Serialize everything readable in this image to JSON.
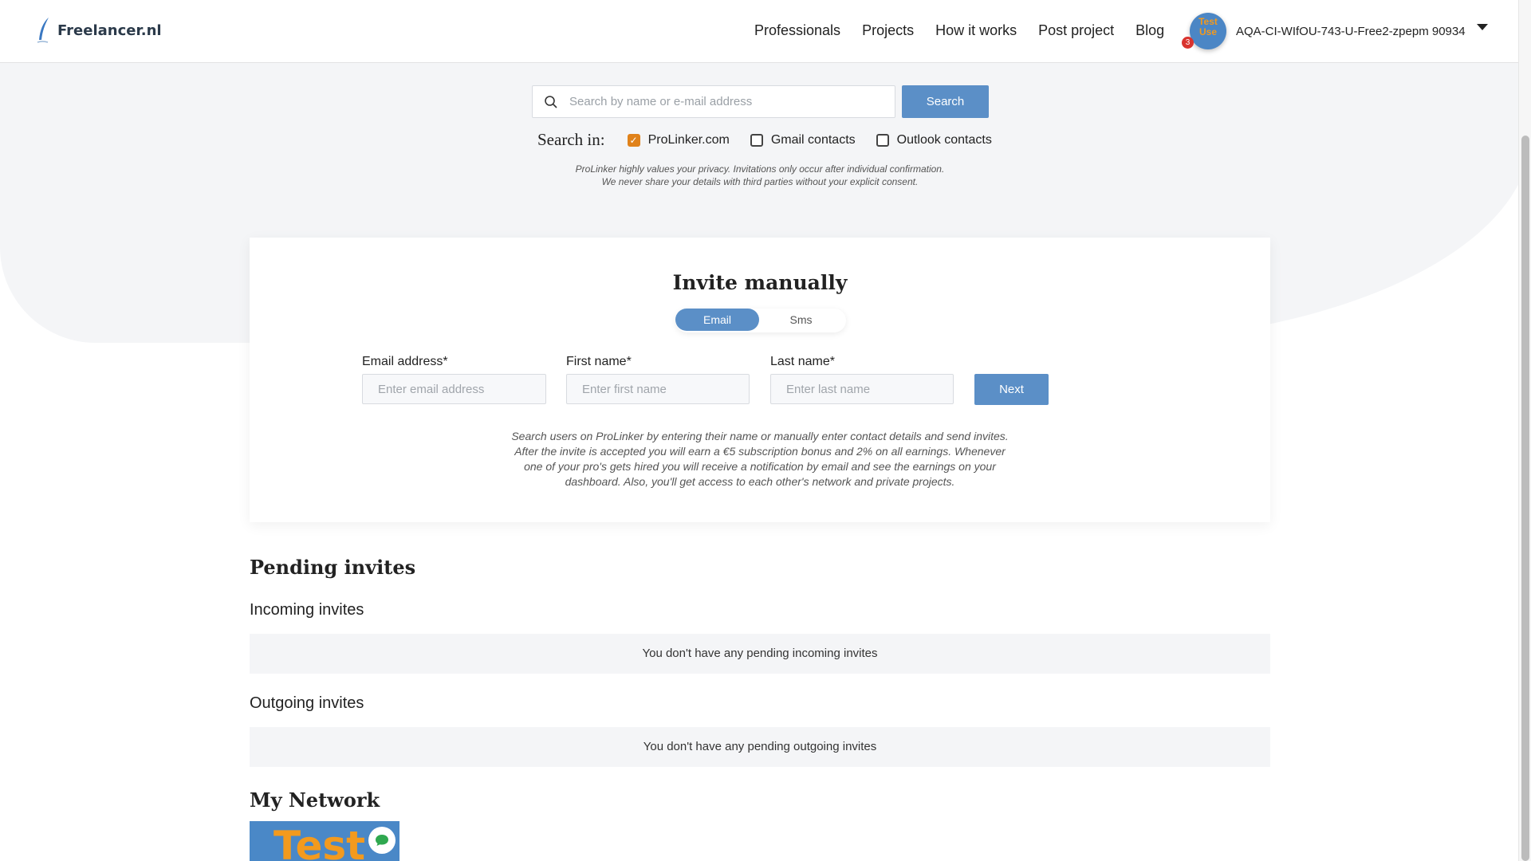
{
  "header": {
    "logo_text": "Freelancer.nl",
    "nav": [
      "Professionals",
      "Projects",
      "How it works",
      "Post project",
      "Blog"
    ],
    "user": {
      "avatar_text_line1": "Test",
      "avatar_text_line2": "Use",
      "notification_count": "3",
      "name": "AQA-CI-WIfOU-743-U-Free2-zpepm 90934"
    }
  },
  "search": {
    "placeholder": "Search by name or e-mail address",
    "button_label": "Search",
    "search_in_label": "Search in:",
    "sources": [
      {
        "label": "ProLinker.com",
        "checked": true
      },
      {
        "label": "Gmail contacts",
        "checked": false
      },
      {
        "label": "Outlook contacts",
        "checked": false
      }
    ],
    "privacy_line1": "ProLinker highly values your privacy. Invitations only occur after individual confirmation.",
    "privacy_line2": "We never share your details with third parties without your explicit consent."
  },
  "invite": {
    "title": "Invite manually",
    "tabs": [
      {
        "label": "Email",
        "active": true
      },
      {
        "label": "Sms",
        "active": false
      }
    ],
    "email_label": "Email address*",
    "email_placeholder": "Enter email address",
    "first_name_label": "First name*",
    "first_name_placeholder": "Enter first name",
    "last_name_label": "Last name*",
    "last_name_placeholder": "Enter last name",
    "next_label": "Next",
    "description": "Search users on ProLinker by entering their name or manually enter contact details and send invites. After the invite is accepted you will earn a €5 subscription bonus and 2% on all earnings. Whenever one of your pro's gets hired you will receive a notification by email and see the earnings on your dashboard. Also, you'll get access to each other's network and private projects."
  },
  "pending": {
    "title": "Pending invites",
    "incoming_title": "Incoming invites",
    "incoming_empty": "You don't have any pending incoming invites",
    "outgoing_title": "Outgoing invites",
    "outgoing_empty": "You don't have any pending outgoing invites"
  },
  "network": {
    "title": "My Network",
    "card_text": "Test"
  },
  "colors": {
    "primary": "#5b8fc7",
    "checkbox_accent": "#e0821a",
    "badge": "#d9332e"
  }
}
